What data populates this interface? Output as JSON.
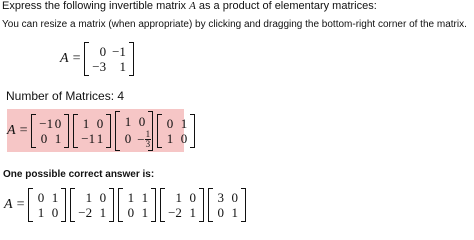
{
  "question": {
    "prompt_prefix": "Express the following invertible matrix ",
    "prompt_var": "A",
    "prompt_suffix": " as a product of elementary matrices:",
    "resize_hint": "You can resize a matrix (when appropriate) by clicking and dragging the bottom-right corner of the matrix.",
    "lhs": "A =",
    "matrix": [
      [
        "0",
        "−1"
      ],
      [
        "−3",
        "1"
      ]
    ]
  },
  "user_answer": {
    "count_label": "Number of Matrices: 4",
    "lhs": "A =",
    "matrices": [
      [
        [
          "−1",
          "0"
        ],
        [
          "0",
          "1"
        ]
      ],
      [
        [
          "1",
          "0"
        ],
        [
          "−1",
          "1"
        ]
      ],
      [
        [
          "1",
          "0"
        ],
        [
          "0",
          "−"
        ]
      ],
      [
        [
          "0",
          "1"
        ],
        [
          "1",
          "0"
        ]
      ]
    ],
    "fraction": {
      "num": "1",
      "den": "3"
    },
    "highlight_color": "#f6c6c6"
  },
  "correct_answer": {
    "title": "One possible correct answer is:",
    "lhs": "A =",
    "matrices": [
      [
        [
          "0",
          "1"
        ],
        [
          "1",
          "0"
        ]
      ],
      [
        [
          "1",
          "0"
        ],
        [
          "−2",
          "1"
        ]
      ],
      [
        [
          "1",
          "1"
        ],
        [
          "0",
          "1"
        ]
      ],
      [
        [
          "1",
          "0"
        ],
        [
          "−2",
          "1"
        ]
      ],
      [
        [
          "3",
          "0"
        ],
        [
          "0",
          "1"
        ]
      ]
    ]
  }
}
